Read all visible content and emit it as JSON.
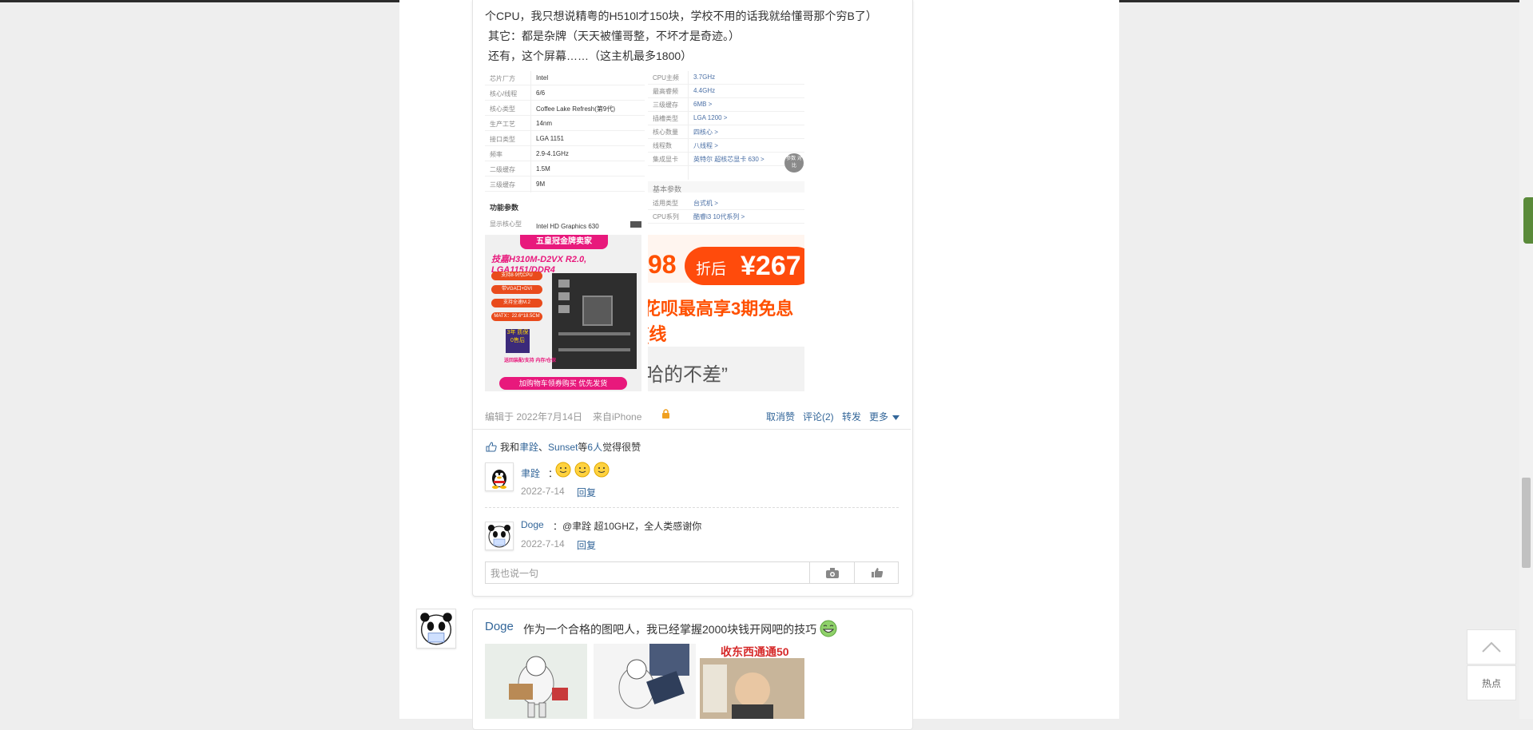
{
  "post": {
    "line1": "个CPU，我只想说精粤的H510l才150块，学校不用的话我就给懂哥那个穷B了）",
    "line2": "其它：都是杂牌（天天被懂哥整，不坏才是奇迹。）",
    "line3": "还有，这个屏幕……（这主机最多1800）"
  },
  "spec_left": {
    "rows": [
      {
        "k": "芯片厂方",
        "v": "Intel"
      },
      {
        "k": "核心/线程",
        "v": "6/6"
      },
      {
        "k": "核心类型",
        "v": "Coffee Lake Refresh(第9代)"
      },
      {
        "k": "生产工艺",
        "v": "14nm"
      },
      {
        "k": "接口类型",
        "v": "LGA 1151"
      },
      {
        "k": "频率",
        "v": "2.9-4.1GHz"
      },
      {
        "k": "二级缓存",
        "v": "1.5M"
      },
      {
        "k": "三级缓存",
        "v": "9M"
      }
    ],
    "section": "功能参数",
    "gpu_label": "显示核心型",
    "gpu_value": "Intel HD Graphics 630"
  },
  "spec_right": {
    "rows": [
      {
        "k": "CPU主频",
        "v": "3.7GHz"
      },
      {
        "k": "最高睿频",
        "v": "4.4GHz"
      },
      {
        "k": "三级缓存",
        "v": "6MB >"
      },
      {
        "k": "插槽类型",
        "v": "LGA 1200 >"
      },
      {
        "k": "核心数量",
        "v": "四核心 >"
      },
      {
        "k": "线程数",
        "v": "八线程 >"
      },
      {
        "k": "集成显卡",
        "v": "英特尔 超核芯显卡 630 >"
      }
    ],
    "section": "基本参数",
    "rows2": [
      {
        "k": "适用类型",
        "v": "台式机 >"
      },
      {
        "k": "CPU系列",
        "v": "酷睿i3 10代系列 >"
      }
    ],
    "float_icon_text": "参数 对比"
  },
  "ad_board": {
    "banner": "五皇冠金牌卖家",
    "title": "技嘉H310M-D2VX R2.0, LGA1151/DDR4",
    "chips": [
      "支持8·9代CPU",
      "带VGA口+DVI",
      "支持全速M.2",
      "MATX：22.6*18.5CM"
    ],
    "badge": "3年 质保 0售后",
    "red_text": "送回装配/支持 内存/仓保",
    "bottom": "加购物车领券购买  优先发货"
  },
  "ad_price": {
    "big": "98",
    "pill_label": "折后",
    "pill_price": "¥267",
    "middle": "花呗最高享3期免息(线",
    "quote": "哈的不差”"
  },
  "meta": {
    "edited": "编辑于 2022年7月14日",
    "source": "来自iPhone",
    "unlike": "取消赞",
    "comments": "评论(2)",
    "forward": "转发",
    "more": "更多"
  },
  "likes": {
    "prefix": "我和",
    "user1": "聿跧",
    "sep": "、",
    "user2": "Sunset",
    "mid": "等",
    "count": "6人",
    "suffix": "觉得很赞"
  },
  "comments": [
    {
      "name": "聿跧",
      "text": "：",
      "date": "2022-7-14",
      "reply": "回复"
    },
    {
      "name": "Doge",
      "text": "：@聿跧 超10GHZ，全人类感谢你",
      "date": "2022-7-14",
      "reply": "回复"
    }
  ],
  "comment_box": {
    "placeholder": "我也说一句"
  },
  "next_post": {
    "name": "Doge",
    "text": "作为一个合格的图吧人，我已经掌握2000块钱开网吧的技巧"
  },
  "thumb3_text": "收东西通通50",
  "float": {
    "hot": "热点"
  }
}
